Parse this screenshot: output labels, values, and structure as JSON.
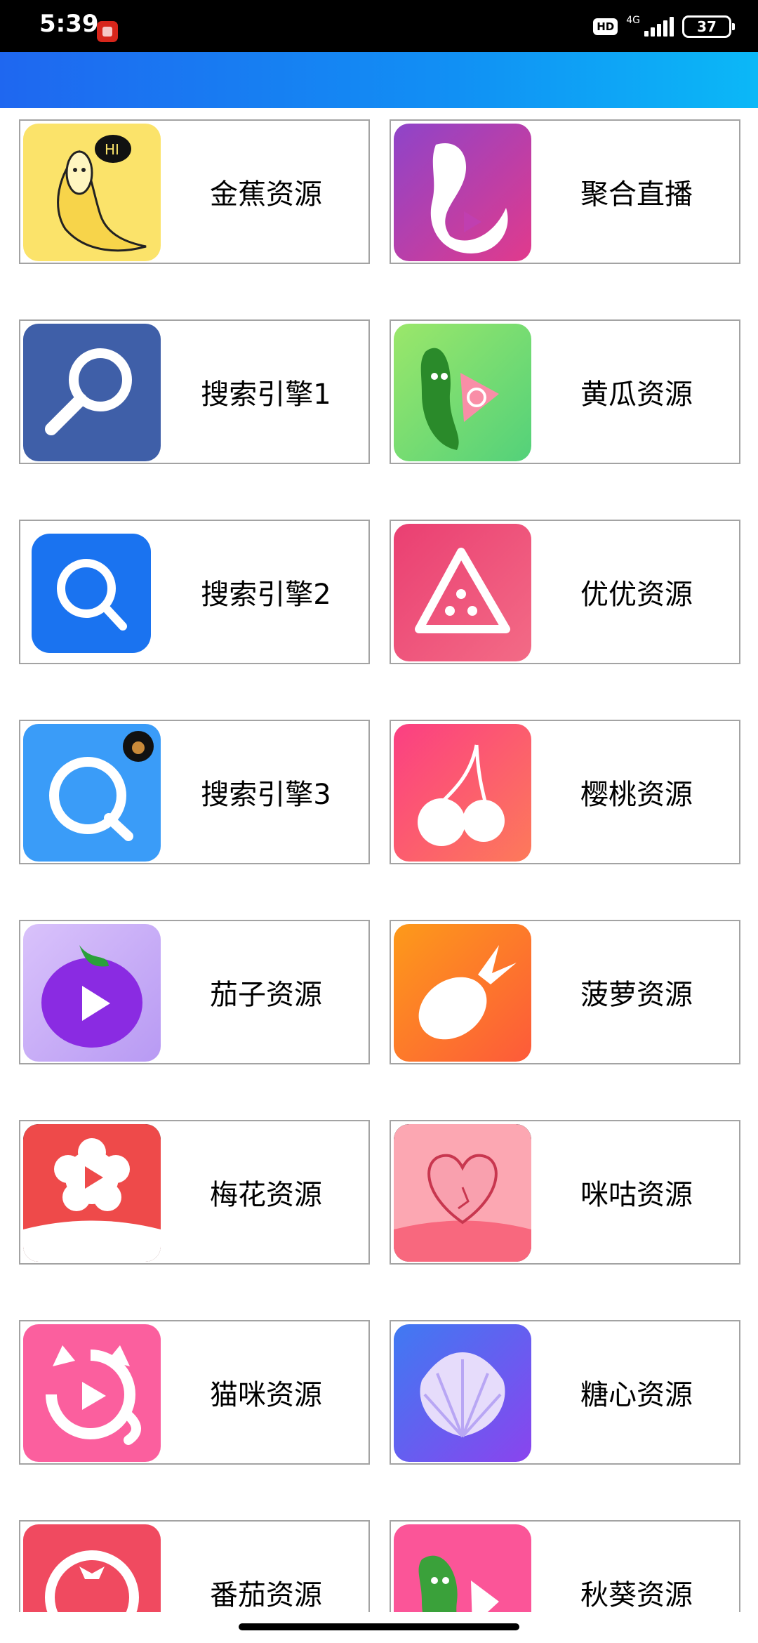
{
  "status_bar": {
    "time": "5:39",
    "hd": "HD",
    "network": "4G",
    "battery": "37"
  },
  "apps": [
    {
      "label": "金蕉资源",
      "icon": "banana-icon",
      "color": "#fbe36a"
    },
    {
      "label": "聚合直播",
      "icon": "mermaid-icon",
      "color": "#c03fb0"
    },
    {
      "label": "搜索引擎1",
      "icon": "magnifier-icon",
      "color": "#3f5fa8"
    },
    {
      "label": "黄瓜资源",
      "icon": "cucumber-icon",
      "color": "#7fe07a"
    },
    {
      "label": "搜索引擎2",
      "icon": "search-blue-icon",
      "color": "#1a73f0"
    },
    {
      "label": "优优资源",
      "icon": "watermelon-icon",
      "color": "#ea3f72"
    },
    {
      "label": "搜索引擎3",
      "icon": "search-q-icon",
      "color": "#3a9cf8"
    },
    {
      "label": "樱桃资源",
      "icon": "cherry-icon",
      "color": "#fb4e7a"
    },
    {
      "label": "茄子资源",
      "icon": "eggplant-icon",
      "color": "#c9a8f7"
    },
    {
      "label": "菠萝资源",
      "icon": "pineapple-icon",
      "color": "#fd7a2b"
    },
    {
      "label": "梅花资源",
      "icon": "plum-blossom-icon",
      "color": "#ee4a4a"
    },
    {
      "label": "咪咕资源",
      "icon": "heart-peach-icon",
      "color": "#fb8fa2"
    },
    {
      "label": "猫咪资源",
      "icon": "cat-play-icon",
      "color": "#fb5f9e"
    },
    {
      "label": "糖心资源",
      "icon": "shell-icon",
      "color": "#6a5cf2"
    },
    {
      "label": "番茄资源",
      "icon": "tomato-icon",
      "color": "#f04a60"
    },
    {
      "label": "秋葵资源",
      "icon": "okra-icon",
      "color": "#fb5598"
    }
  ]
}
